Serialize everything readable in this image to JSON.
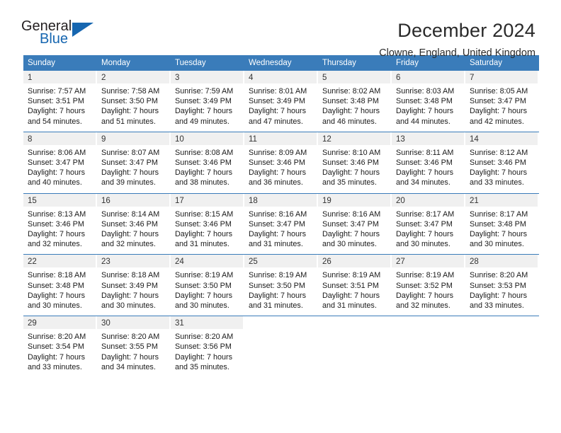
{
  "logo": {
    "word_one": "General",
    "word_two": "Blue",
    "triangle_icon": "blue-triangle-icon"
  },
  "header": {
    "month_title": "December 2024",
    "location": "Clowne, England, United Kingdom"
  },
  "colors": {
    "header_blue": "#3a7cba",
    "day_number_bg": "#f0f0f0",
    "logo_blue": "#1666b0",
    "text": "#1a1a1a"
  },
  "weekdays": [
    "Sunday",
    "Monday",
    "Tuesday",
    "Wednesday",
    "Thursday",
    "Friday",
    "Saturday"
  ],
  "weeks": [
    [
      {
        "day": "1",
        "sunrise": "Sunrise: 7:57 AM",
        "sunset": "Sunset: 3:51 PM",
        "daylight_line1": "Daylight: 7 hours",
        "daylight_line2": "and 54 minutes."
      },
      {
        "day": "2",
        "sunrise": "Sunrise: 7:58 AM",
        "sunset": "Sunset: 3:50 PM",
        "daylight_line1": "Daylight: 7 hours",
        "daylight_line2": "and 51 minutes."
      },
      {
        "day": "3",
        "sunrise": "Sunrise: 7:59 AM",
        "sunset": "Sunset: 3:49 PM",
        "daylight_line1": "Daylight: 7 hours",
        "daylight_line2": "and 49 minutes."
      },
      {
        "day": "4",
        "sunrise": "Sunrise: 8:01 AM",
        "sunset": "Sunset: 3:49 PM",
        "daylight_line1": "Daylight: 7 hours",
        "daylight_line2": "and 47 minutes."
      },
      {
        "day": "5",
        "sunrise": "Sunrise: 8:02 AM",
        "sunset": "Sunset: 3:48 PM",
        "daylight_line1": "Daylight: 7 hours",
        "daylight_line2": "and 46 minutes."
      },
      {
        "day": "6",
        "sunrise": "Sunrise: 8:03 AM",
        "sunset": "Sunset: 3:48 PM",
        "daylight_line1": "Daylight: 7 hours",
        "daylight_line2": "and 44 minutes."
      },
      {
        "day": "7",
        "sunrise": "Sunrise: 8:05 AM",
        "sunset": "Sunset: 3:47 PM",
        "daylight_line1": "Daylight: 7 hours",
        "daylight_line2": "and 42 minutes."
      }
    ],
    [
      {
        "day": "8",
        "sunrise": "Sunrise: 8:06 AM",
        "sunset": "Sunset: 3:47 PM",
        "daylight_line1": "Daylight: 7 hours",
        "daylight_line2": "and 40 minutes."
      },
      {
        "day": "9",
        "sunrise": "Sunrise: 8:07 AM",
        "sunset": "Sunset: 3:47 PM",
        "daylight_line1": "Daylight: 7 hours",
        "daylight_line2": "and 39 minutes."
      },
      {
        "day": "10",
        "sunrise": "Sunrise: 8:08 AM",
        "sunset": "Sunset: 3:46 PM",
        "daylight_line1": "Daylight: 7 hours",
        "daylight_line2": "and 38 minutes."
      },
      {
        "day": "11",
        "sunrise": "Sunrise: 8:09 AM",
        "sunset": "Sunset: 3:46 PM",
        "daylight_line1": "Daylight: 7 hours",
        "daylight_line2": "and 36 minutes."
      },
      {
        "day": "12",
        "sunrise": "Sunrise: 8:10 AM",
        "sunset": "Sunset: 3:46 PM",
        "daylight_line1": "Daylight: 7 hours",
        "daylight_line2": "and 35 minutes."
      },
      {
        "day": "13",
        "sunrise": "Sunrise: 8:11 AM",
        "sunset": "Sunset: 3:46 PM",
        "daylight_line1": "Daylight: 7 hours",
        "daylight_line2": "and 34 minutes."
      },
      {
        "day": "14",
        "sunrise": "Sunrise: 8:12 AM",
        "sunset": "Sunset: 3:46 PM",
        "daylight_line1": "Daylight: 7 hours",
        "daylight_line2": "and 33 minutes."
      }
    ],
    [
      {
        "day": "15",
        "sunrise": "Sunrise: 8:13 AM",
        "sunset": "Sunset: 3:46 PM",
        "daylight_line1": "Daylight: 7 hours",
        "daylight_line2": "and 32 minutes."
      },
      {
        "day": "16",
        "sunrise": "Sunrise: 8:14 AM",
        "sunset": "Sunset: 3:46 PM",
        "daylight_line1": "Daylight: 7 hours",
        "daylight_line2": "and 32 minutes."
      },
      {
        "day": "17",
        "sunrise": "Sunrise: 8:15 AM",
        "sunset": "Sunset: 3:46 PM",
        "daylight_line1": "Daylight: 7 hours",
        "daylight_line2": "and 31 minutes."
      },
      {
        "day": "18",
        "sunrise": "Sunrise: 8:16 AM",
        "sunset": "Sunset: 3:47 PM",
        "daylight_line1": "Daylight: 7 hours",
        "daylight_line2": "and 31 minutes."
      },
      {
        "day": "19",
        "sunrise": "Sunrise: 8:16 AM",
        "sunset": "Sunset: 3:47 PM",
        "daylight_line1": "Daylight: 7 hours",
        "daylight_line2": "and 30 minutes."
      },
      {
        "day": "20",
        "sunrise": "Sunrise: 8:17 AM",
        "sunset": "Sunset: 3:47 PM",
        "daylight_line1": "Daylight: 7 hours",
        "daylight_line2": "and 30 minutes."
      },
      {
        "day": "21",
        "sunrise": "Sunrise: 8:17 AM",
        "sunset": "Sunset: 3:48 PM",
        "daylight_line1": "Daylight: 7 hours",
        "daylight_line2": "and 30 minutes."
      }
    ],
    [
      {
        "day": "22",
        "sunrise": "Sunrise: 8:18 AM",
        "sunset": "Sunset: 3:48 PM",
        "daylight_line1": "Daylight: 7 hours",
        "daylight_line2": "and 30 minutes."
      },
      {
        "day": "23",
        "sunrise": "Sunrise: 8:18 AM",
        "sunset": "Sunset: 3:49 PM",
        "daylight_line1": "Daylight: 7 hours",
        "daylight_line2": "and 30 minutes."
      },
      {
        "day": "24",
        "sunrise": "Sunrise: 8:19 AM",
        "sunset": "Sunset: 3:50 PM",
        "daylight_line1": "Daylight: 7 hours",
        "daylight_line2": "and 30 minutes."
      },
      {
        "day": "25",
        "sunrise": "Sunrise: 8:19 AM",
        "sunset": "Sunset: 3:50 PM",
        "daylight_line1": "Daylight: 7 hours",
        "daylight_line2": "and 31 minutes."
      },
      {
        "day": "26",
        "sunrise": "Sunrise: 8:19 AM",
        "sunset": "Sunset: 3:51 PM",
        "daylight_line1": "Daylight: 7 hours",
        "daylight_line2": "and 31 minutes."
      },
      {
        "day": "27",
        "sunrise": "Sunrise: 8:19 AM",
        "sunset": "Sunset: 3:52 PM",
        "daylight_line1": "Daylight: 7 hours",
        "daylight_line2": "and 32 minutes."
      },
      {
        "day": "28",
        "sunrise": "Sunrise: 8:20 AM",
        "sunset": "Sunset: 3:53 PM",
        "daylight_line1": "Daylight: 7 hours",
        "daylight_line2": "and 33 minutes."
      }
    ],
    [
      {
        "day": "29",
        "sunrise": "Sunrise: 8:20 AM",
        "sunset": "Sunset: 3:54 PM",
        "daylight_line1": "Daylight: 7 hours",
        "daylight_line2": "and 33 minutes."
      },
      {
        "day": "30",
        "sunrise": "Sunrise: 8:20 AM",
        "sunset": "Sunset: 3:55 PM",
        "daylight_line1": "Daylight: 7 hours",
        "daylight_line2": "and 34 minutes."
      },
      {
        "day": "31",
        "sunrise": "Sunrise: 8:20 AM",
        "sunset": "Sunset: 3:56 PM",
        "daylight_line1": "Daylight: 7 hours",
        "daylight_line2": "and 35 minutes."
      },
      {
        "day": "",
        "sunrise": "",
        "sunset": "",
        "daylight_line1": "",
        "daylight_line2": ""
      },
      {
        "day": "",
        "sunrise": "",
        "sunset": "",
        "daylight_line1": "",
        "daylight_line2": ""
      },
      {
        "day": "",
        "sunrise": "",
        "sunset": "",
        "daylight_line1": "",
        "daylight_line2": ""
      },
      {
        "day": "",
        "sunrise": "",
        "sunset": "",
        "daylight_line1": "",
        "daylight_line2": ""
      }
    ]
  ]
}
